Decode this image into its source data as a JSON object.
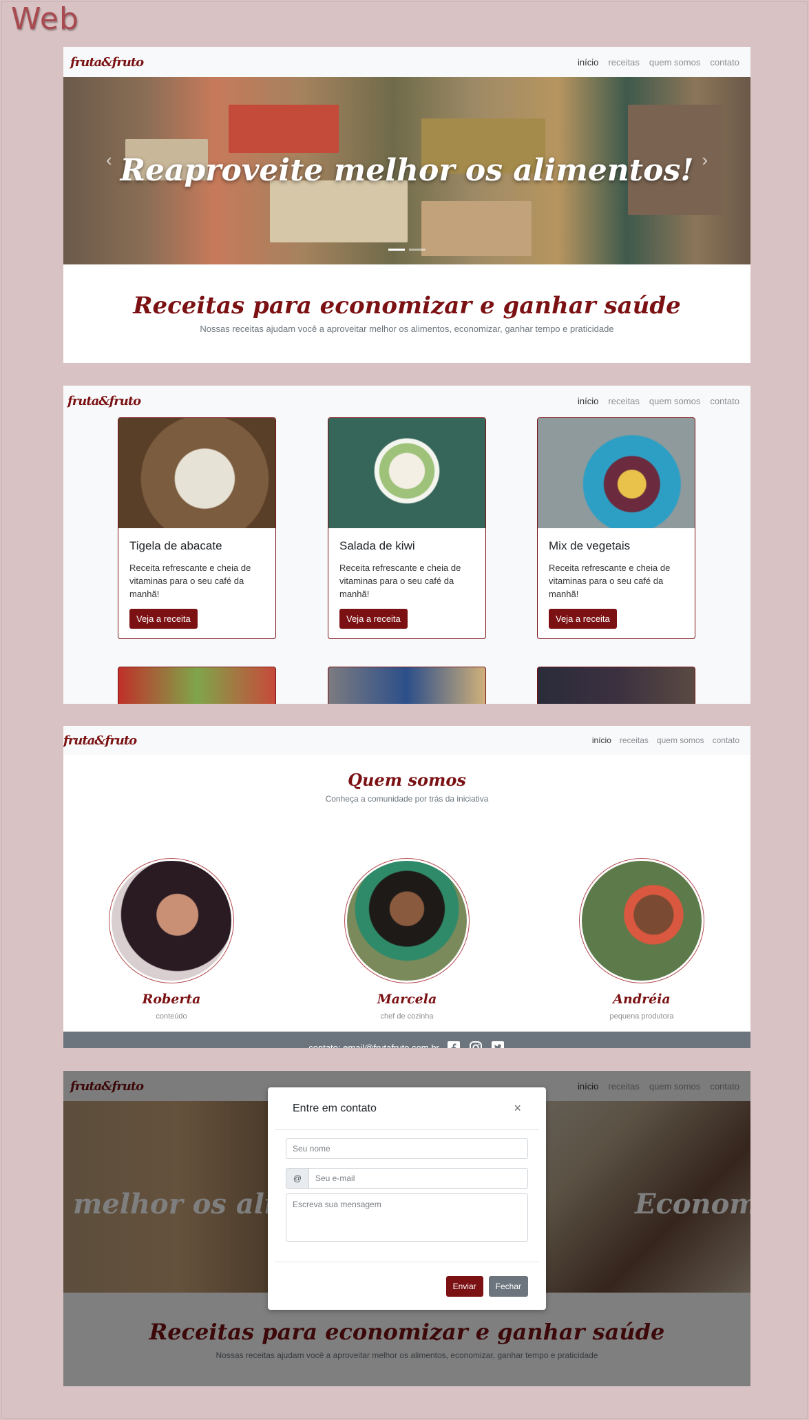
{
  "label": "Web",
  "brand": "fruta&fruto",
  "nav": [
    "início",
    "receitas",
    "quem somos",
    "contato"
  ],
  "hero": {
    "title": "Reaproveite melhor os alimentos!",
    "side_left": "melhor os alim",
    "side_right": "Economiz"
  },
  "intro": {
    "title": "Receitas para economizar e ganhar saúde",
    "subtitle": "Nossas receitas ajudam você a aproveitar melhor os alimentos, economizar, ganhar tempo e praticidade"
  },
  "recipes": [
    {
      "title": "Tigela de abacate",
      "text": "Receita refrescante e cheia de vitaminas para o seu café da manhã!",
      "button": "Veja a receita"
    },
    {
      "title": "Salada de kiwi",
      "text": "Receita refrescante e cheia de vitaminas para o seu café da manhã!",
      "button": "Veja a receita"
    },
    {
      "title": "Mix de vegetais",
      "text": "Receita refrescante e cheia de vitaminas para o seu café da manhã!",
      "button": "Veja a receita"
    }
  ],
  "about": {
    "title": "Quem somos",
    "subtitle": "Conheça a comunidade por trás da iniciativa",
    "members": [
      {
        "name": "Roberta",
        "role": "conteúdo"
      },
      {
        "name": "Marcela",
        "role": "chef de cozinha"
      },
      {
        "name": "Andréia",
        "role": "pequena produtora"
      }
    ]
  },
  "footer": {
    "contact": "contato: email@frutafruto.com.br",
    "icons": [
      "facebook-icon",
      "instagram-icon",
      "twitter-icon"
    ]
  },
  "modal": {
    "title": "Entre em contato",
    "close": "×",
    "name_placeholder": "Seu nome",
    "at": "@",
    "email_placeholder": "Seu e-mail",
    "message_placeholder": "Escreva sua mensagem",
    "send": "Enviar",
    "close_button": "Fechar"
  },
  "colors": {
    "brand": "#7b1113",
    "background": "#d9c2c4",
    "footer": "#6c757d"
  }
}
